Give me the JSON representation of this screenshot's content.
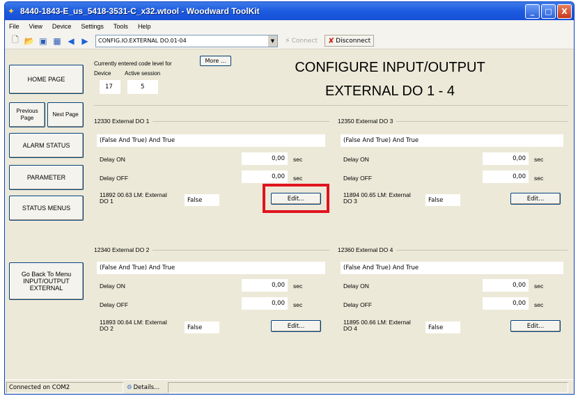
{
  "window": {
    "title": "8440-1843-E_us_5418-3531-C_x32.wtool - Woodward ToolKit",
    "minimize": "_",
    "maximize": "□",
    "close": "X"
  },
  "menu": [
    "File",
    "View",
    "Device",
    "Settings",
    "Tools",
    "Help"
  ],
  "toolbar": {
    "address": "CONFIG.IO.EXTERNAL DO.01-04",
    "connect": "Connect",
    "disconnect": "Disconnect"
  },
  "sidebar": {
    "home": "HOME PAGE",
    "previous": "Previous Page",
    "next": "Next Page",
    "alarm": "ALARM STATUS",
    "parameter": "PARAMETER",
    "status_menus": "STATUS MENUS",
    "go_back": "Go Back To Menu INPUT/OUTPUT EXTERNAL"
  },
  "header": {
    "code_level_text": "Currently entered code level for",
    "device_label": "Device",
    "session_label": "Active session",
    "device_value": "17",
    "session_value": "5",
    "more": "More ...",
    "title_line1": "CONFIGURE INPUT/OUTPUT",
    "title_line2": "EXTERNAL DO 1 - 4"
  },
  "groups": [
    {
      "label": "12330 External DO 1",
      "logic": "(False And True) And True",
      "delay_on_label": "Delay ON",
      "delay_on": "0,00",
      "delay_off_label": "Delay OFF",
      "delay_off": "0,00",
      "unit": "sec",
      "lm_label": "11892 00.63 LM: External DO 1",
      "lm_value": "False",
      "edit": "Edit..."
    },
    {
      "label": "12350 External DO 3",
      "logic": "(False And True) And True",
      "delay_on_label": "Delay ON",
      "delay_on": "0,00",
      "delay_off_label": "Delay OFF",
      "delay_off": "0,00",
      "unit": "sec",
      "lm_label": "11894 00.65 LM: External DO 3",
      "lm_value": "False",
      "edit": "Edit..."
    },
    {
      "label": "12340 External DO 2",
      "logic": "(False And True) And True",
      "delay_on_label": "Delay ON",
      "delay_on": "0,00",
      "delay_off_label": "Delay OFF",
      "delay_off": "0,00",
      "unit": "sec",
      "lm_label": "11893 00.64 LM: External DO 2",
      "lm_value": "False",
      "edit": "Edit..."
    },
    {
      "label": "12360 External DO 4",
      "logic": "(False And True) And True",
      "delay_on_label": "Delay ON",
      "delay_on": "0,00",
      "delay_off_label": "Delay OFF",
      "delay_off": "0,00",
      "unit": "sec",
      "lm_label": "11895 00.66 LM: External DO 4",
      "lm_value": "False",
      "edit": "Edit..."
    }
  ],
  "statusbar": {
    "connection": "Connected on COM2",
    "details": "Details..."
  },
  "colors": {
    "highlight": "#e0141e",
    "titlebar": "#1c5be0"
  }
}
